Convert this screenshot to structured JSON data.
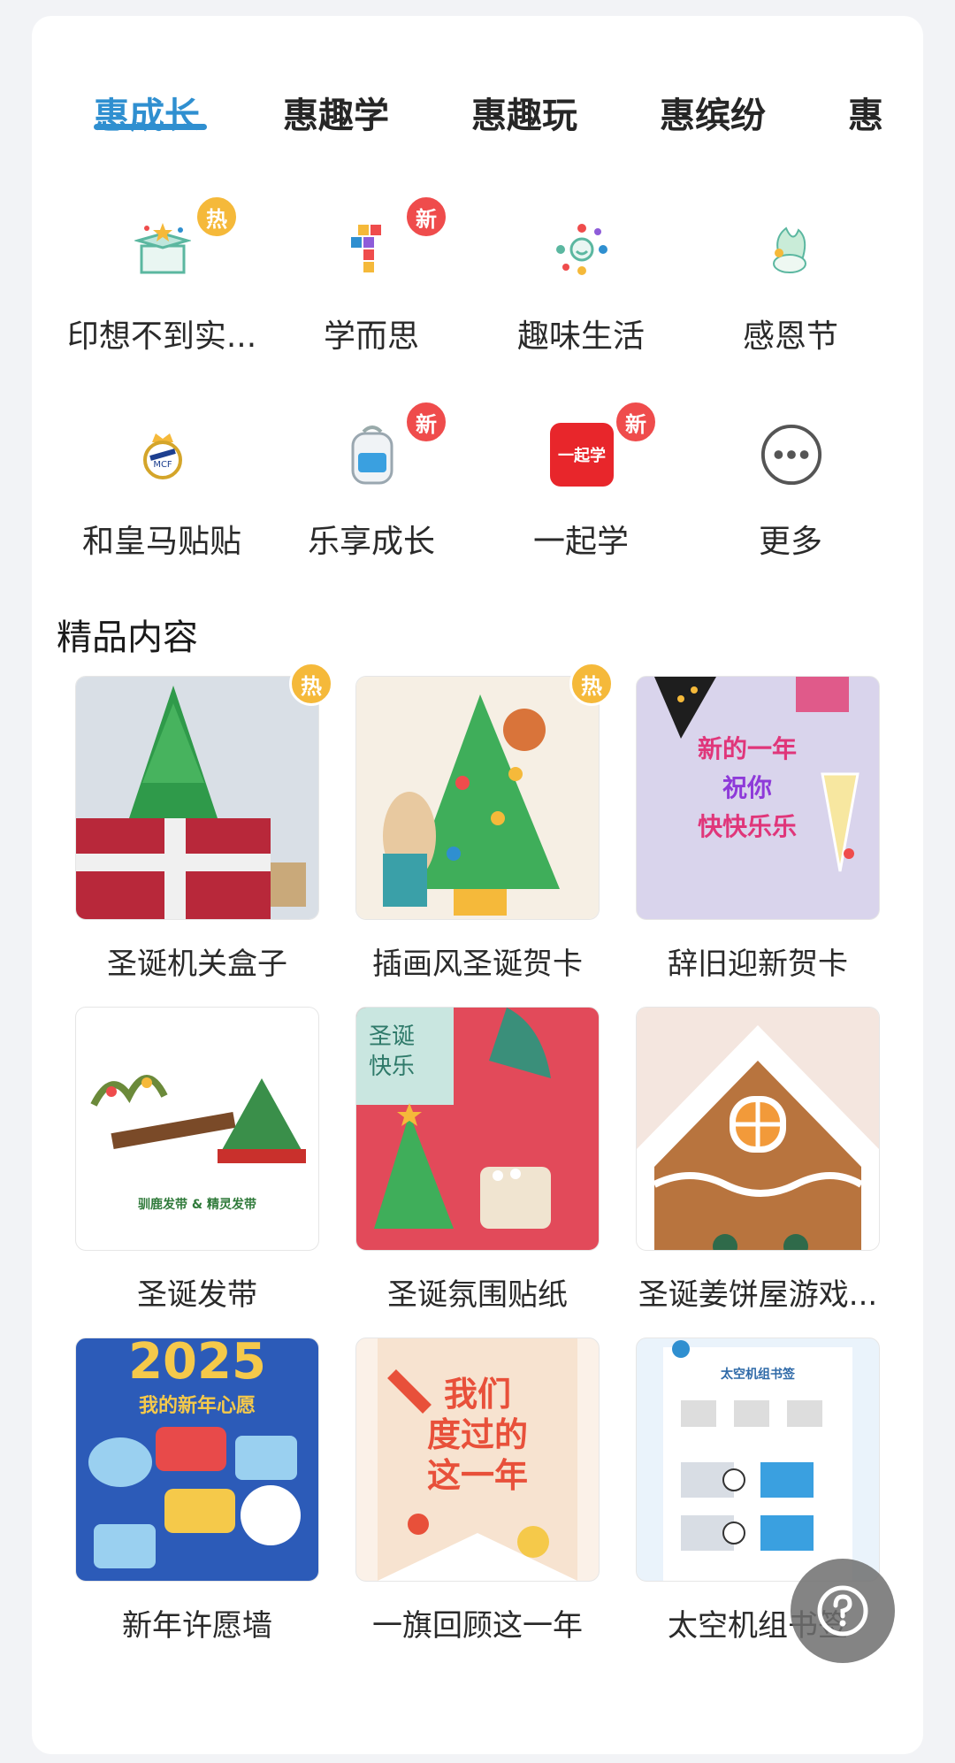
{
  "tabs": [
    "惠成长",
    "惠趣学",
    "惠趣玩",
    "惠缤纷",
    "惠"
  ],
  "badges": {
    "hot": "热",
    "new": "新"
  },
  "icons": [
    {
      "label": "印想不到实...",
      "icon": "gift-box-icon",
      "badge": "hot"
    },
    {
      "label": "学而思",
      "icon": "colored-blocks-icon",
      "badge": "new"
    },
    {
      "label": "趣味生活",
      "icon": "life-circle-icon",
      "badge": ""
    },
    {
      "label": "感恩节",
      "icon": "peacock-icon",
      "badge": ""
    },
    {
      "label": "和皇马贴贴",
      "icon": "real-madrid-crest-icon",
      "badge": ""
    },
    {
      "label": "乐享成长",
      "icon": "backpack-icon",
      "badge": "new"
    },
    {
      "label": "一起学",
      "icon": "yiqixue-logo-icon",
      "icon_text": "一起学",
      "badge": "new"
    },
    {
      "label": "更多",
      "icon": "more-icon",
      "badge": ""
    }
  ],
  "section_title": "精品内容",
  "tiles": [
    {
      "label": "圣诞机关盒子",
      "badge": "hot"
    },
    {
      "label": "插画风圣诞贺卡",
      "badge": "hot"
    },
    {
      "label": "辞旧迎新贺卡",
      "image_text": [
        "新的一年",
        "祝你",
        "快快乐乐"
      ],
      "badge": ""
    },
    {
      "label": "圣诞发带",
      "image_text": [
        "驯鹿发带 & 精灵发带"
      ],
      "badge": ""
    },
    {
      "label": "圣诞氛围贴纸",
      "image_text": [
        "圣诞",
        "快乐"
      ],
      "badge": ""
    },
    {
      "label": "圣诞姜饼屋游戏...",
      "badge": ""
    },
    {
      "label": "新年许愿墙",
      "image_text": [
        "2025",
        "我的新年心愿"
      ],
      "badge": ""
    },
    {
      "label": "一旗回顾这一年",
      "image_text": [
        "我们",
        "度过的",
        "这一年"
      ],
      "badge": ""
    },
    {
      "label": "太空机组书签",
      "image_text": [
        "太空机组书签"
      ],
      "badge": ""
    }
  ],
  "colors": {
    "accent": "#2f8fd0",
    "hot": "#f5b93a",
    "new": "#ef4c4c"
  }
}
